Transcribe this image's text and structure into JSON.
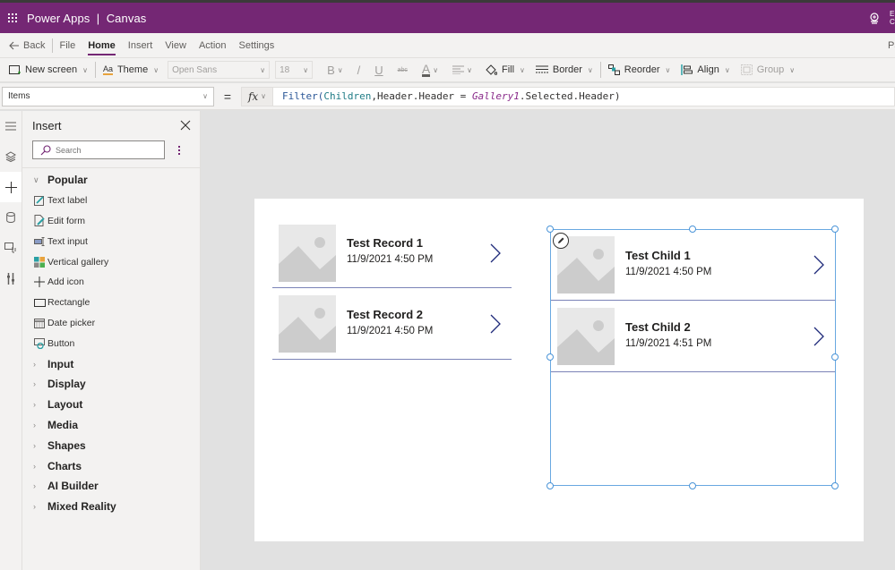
{
  "appbar": {
    "title": "Power Apps  |  Canvas",
    "right_cut_text": "E C",
    "waffle_icon": "waffle-icon",
    "cert_icon": "app-checker-icon"
  },
  "menubar": {
    "back_label": "Back",
    "items": [
      {
        "label": "File",
        "active": false
      },
      {
        "label": "Home",
        "active": true
      },
      {
        "label": "Insert",
        "active": false
      },
      {
        "label": "View",
        "active": false
      },
      {
        "label": "Action",
        "active": false
      },
      {
        "label": "Settings",
        "active": false
      }
    ],
    "right_cut_text": "Pa"
  },
  "toolbar": {
    "new_screen": "New screen",
    "theme": "Theme",
    "font": "Open Sans",
    "font_size": "18",
    "bold": "B",
    "italic": "/",
    "underline": "U",
    "strike": "abc",
    "font_color": "A",
    "fill": "Fill",
    "border": "Border",
    "reorder": "Reorder",
    "align": "Align",
    "group": "Group"
  },
  "formulabar": {
    "property": "Items",
    "equals": "=",
    "fx": "fx",
    "formula": {
      "fn": "Filter(",
      "source": "Children",
      "mid": ",Header.Header = ",
      "control": "Gallery1",
      "tail": ".Selected.Header)"
    }
  },
  "rail": {
    "items": [
      {
        "icon": "hamburger-icon",
        "active": false
      },
      {
        "icon": "layers-icon",
        "active": false
      },
      {
        "icon": "plus-icon",
        "active": true
      },
      {
        "icon": "database-icon",
        "active": false
      },
      {
        "icon": "media-icon",
        "active": false
      },
      {
        "icon": "advanced-tools-icon",
        "active": false
      }
    ]
  },
  "insert_pane": {
    "title": "Insert",
    "search_placeholder": "Search",
    "popular_label": "Popular",
    "popular_items": [
      {
        "label": "Text label",
        "icon": "text-label-icon"
      },
      {
        "label": "Edit form",
        "icon": "edit-form-icon"
      },
      {
        "label": "Text input",
        "icon": "text-input-icon"
      },
      {
        "label": "Vertical gallery",
        "icon": "vertical-gallery-icon"
      },
      {
        "label": "Add icon",
        "icon": "add-icon-icon"
      },
      {
        "label": "Rectangle",
        "icon": "rectangle-icon"
      },
      {
        "label": "Date picker",
        "icon": "date-picker-icon"
      },
      {
        "label": "Button",
        "icon": "button-icon"
      }
    ],
    "categories": [
      "Input",
      "Display",
      "Layout",
      "Media",
      "Shapes",
      "Charts",
      "AI Builder",
      "Mixed Reality"
    ]
  },
  "canvas": {
    "gallery1": [
      {
        "title": "Test Record 1",
        "date": "11/9/2021 4:50 PM"
      },
      {
        "title": "Test Record 2",
        "date": "11/9/2021 4:50 PM"
      }
    ],
    "gallery2": [
      {
        "title": "Test Child 1",
        "date": "11/9/2021 4:50 PM"
      },
      {
        "title": "Test Child 2",
        "date": "11/9/2021 4:51 PM"
      }
    ]
  },
  "colors": {
    "brand": "#742774",
    "separator": "#7b83b7",
    "chevron": "#1f2a7a",
    "selection": "#69a8e1"
  }
}
